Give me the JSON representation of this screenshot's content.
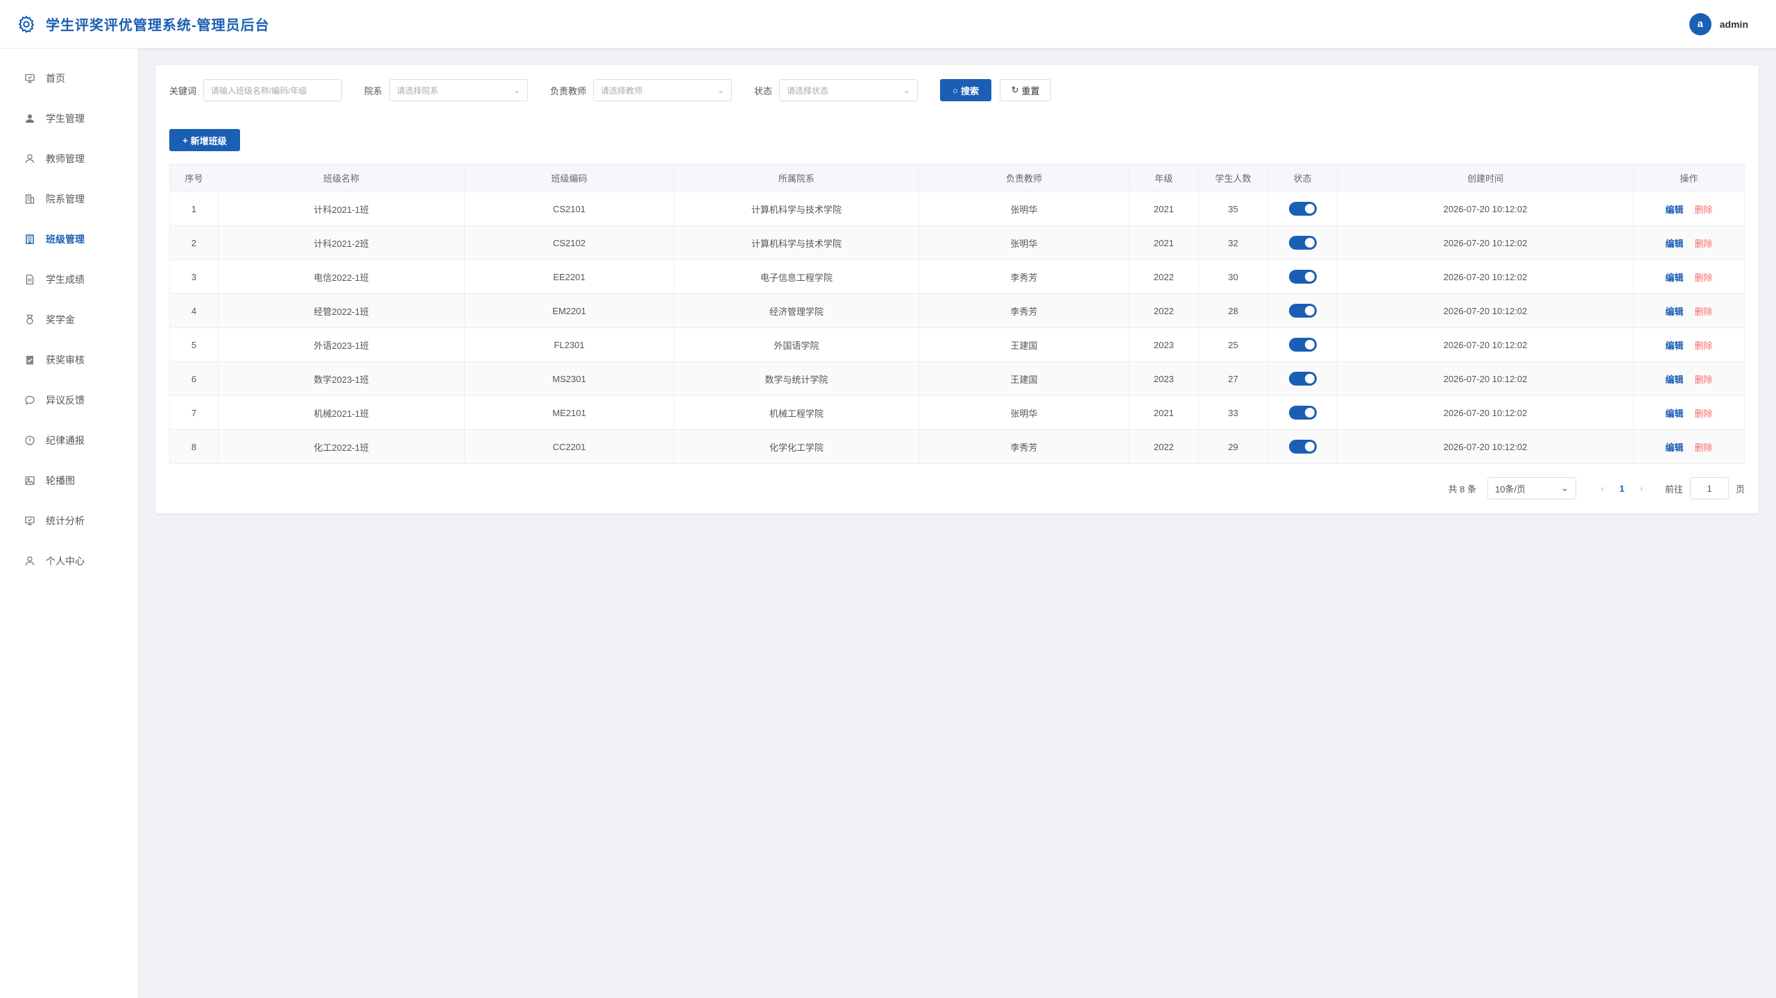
{
  "header": {
    "title": "学生评奖评优管理系统-管理员后台",
    "avatar_letter": "a",
    "username": "admin",
    "brand_color": "#1a5fb4"
  },
  "sidebar": {
    "items": [
      {
        "label": "首页",
        "icon": "monitor-icon"
      },
      {
        "label": "学生管理",
        "icon": "user-solid-icon"
      },
      {
        "label": "教师管理",
        "icon": "user-icon"
      },
      {
        "label": "院系管理",
        "icon": "building-icon"
      },
      {
        "label": "班级管理",
        "icon": "office-icon",
        "active": true
      },
      {
        "label": "学生成绩",
        "icon": "document-icon"
      },
      {
        "label": "奖学金",
        "icon": "medal-icon"
      },
      {
        "label": "获奖审核",
        "icon": "checklist-icon"
      },
      {
        "label": "异议反馈",
        "icon": "chat-icon"
      },
      {
        "label": "纪律通报",
        "icon": "warning-icon"
      },
      {
        "label": "轮播图",
        "icon": "picture-icon"
      },
      {
        "label": "统计分析",
        "icon": "monitor-icon"
      },
      {
        "label": "个人中心",
        "icon": "user-icon"
      }
    ]
  },
  "filters": {
    "keyword_label": "关键词",
    "keyword_placeholder": "请输入班级名称/编码/年级",
    "dept_label": "院系",
    "dept_placeholder": "请选择院系",
    "teacher_label": "负责教师",
    "teacher_placeholder": "请选择教师",
    "status_label": "状态",
    "status_placeholder": "请选择状态",
    "search_label": "搜索",
    "reset_label": "重置"
  },
  "add_button": "新增班级",
  "table": {
    "columns": [
      "序号",
      "班级名称",
      "班级编码",
      "所属院系",
      "负责教师",
      "年级",
      "学生人数",
      "状态",
      "创建时间",
      "操作"
    ],
    "rows": [
      {
        "no": "1",
        "name": "计科2021-1班",
        "code": "CS2101",
        "dept": "计算机科学与技术学院",
        "teacher": "张明华",
        "grade": "2021",
        "count": "35",
        "created": "2026-07-20 10:12:02"
      },
      {
        "no": "2",
        "name": "计科2021-2班",
        "code": "CS2102",
        "dept": "计算机科学与技术学院",
        "teacher": "张明华",
        "grade": "2021",
        "count": "32",
        "created": "2026-07-20 10:12:02"
      },
      {
        "no": "3",
        "name": "电信2022-1班",
        "code": "EE2201",
        "dept": "电子信息工程学院",
        "teacher": "李秀芳",
        "grade": "2022",
        "count": "30",
        "created": "2026-07-20 10:12:02"
      },
      {
        "no": "4",
        "name": "经管2022-1班",
        "code": "EM2201",
        "dept": "经济管理学院",
        "teacher": "李秀芳",
        "grade": "2022",
        "count": "28",
        "created": "2026-07-20 10:12:02"
      },
      {
        "no": "5",
        "name": "外语2023-1班",
        "code": "FL2301",
        "dept": "外国语学院",
        "teacher": "王建国",
        "grade": "2023",
        "count": "25",
        "created": "2026-07-20 10:12:02"
      },
      {
        "no": "6",
        "name": "数学2023-1班",
        "code": "MS2301",
        "dept": "数学与统计学院",
        "teacher": "王建国",
        "grade": "2023",
        "count": "27",
        "created": "2026-07-20 10:12:02"
      },
      {
        "no": "7",
        "name": "机械2021-1班",
        "code": "ME2101",
        "dept": "机械工程学院",
        "teacher": "张明华",
        "grade": "2021",
        "count": "33",
        "created": "2026-07-20 10:12:02"
      },
      {
        "no": "8",
        "name": "化工2022-1班",
        "code": "CC2201",
        "dept": "化学化工学院",
        "teacher": "李秀芳",
        "grade": "2022",
        "count": "29",
        "created": "2026-07-20 10:12:02"
      }
    ],
    "edit_label": "编辑",
    "delete_label": "删除"
  },
  "pagination": {
    "total": "共 8 条",
    "page_size": "10条/页",
    "current_page": "1",
    "goto_label": "前往",
    "goto_value": "1",
    "page_unit": "页"
  }
}
